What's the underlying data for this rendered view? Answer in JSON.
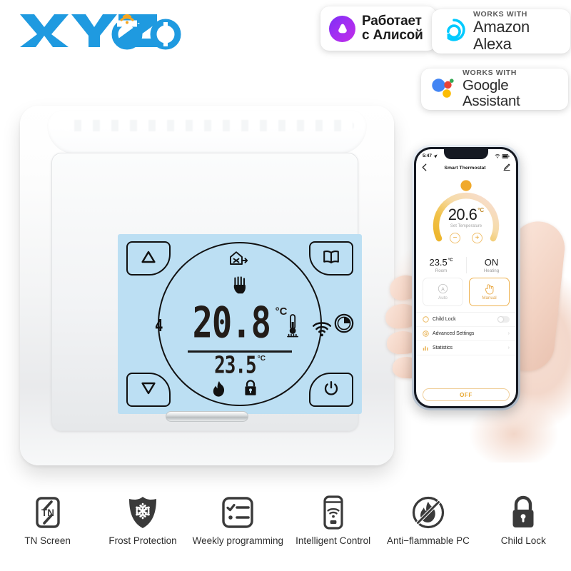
{
  "brand": {
    "logo_text": "XYZOO",
    "logo_color": "#1f9ae0",
    "logo_accent_color": "#f5a623"
  },
  "badges": [
    {
      "id": "alice",
      "icon": "yandex-alice-icon",
      "line1": "Работает",
      "line2": "с Алисой",
      "color": "#9B30E8"
    },
    {
      "id": "alexa",
      "icon": "amazon-alexa-icon",
      "kicker": "WORKS WITH",
      "name": "Amazon Alexa",
      "color": "#00CAFF"
    },
    {
      "id": "google",
      "icon": "google-assistant-icon",
      "kicker": "WORKS WITH",
      "name": "Google Assistant",
      "colors": [
        "#4285F4",
        "#EA4335",
        "#FBBC05",
        "#34A853"
      ]
    }
  ],
  "thermostat": {
    "lcd": {
      "background_color": "#bcdff3",
      "main_temp": "20.8",
      "main_unit": "°C",
      "set_temp": "23.5",
      "set_unit": "°C",
      "day_indicator": "4",
      "icons": {
        "up_key": "up-arrow-icon",
        "book_key": "program-book-icon",
        "down_key": "down-arrow-icon",
        "power_key": "power-icon",
        "frost_house": "frost-protection-house-icon",
        "hand": "manual-hand-icon",
        "thermometer": "floor-sensor-thermometer-icon",
        "wifi": "wifi-icon",
        "clock": "clock-icon",
        "flame": "heating-flame-icon",
        "lock": "child-lock-icon"
      }
    }
  },
  "phone": {
    "status_bar": {
      "time": "5:47",
      "location_icon": "location-arrow-icon",
      "wifi_icon": "wifi-icon",
      "battery_icon": "battery-icon"
    },
    "nav": {
      "back_icon": "back-chevron-icon",
      "title": "Smart Thermostat",
      "edit_icon": "edit-pencil-icon"
    },
    "dial": {
      "set_temperature": "20.6",
      "unit": "°C",
      "caption": "Set Temperature",
      "minus_label": "−",
      "plus_label": "+",
      "arc_color_start": "#f0b323",
      "arc_color_end": "#f7d7d2",
      "knob_color": "#f0a92b"
    },
    "readouts": [
      {
        "value": "23.5",
        "unit": "°C",
        "caption": "Room"
      },
      {
        "value": "ON",
        "unit": "",
        "caption": "Heating"
      }
    ],
    "modes": [
      {
        "label": "Auto",
        "icon": "auto-mode-icon",
        "selected": false
      },
      {
        "label": "Manual",
        "icon": "manual-hand-icon",
        "selected": true
      }
    ],
    "rows": [
      {
        "label": "Child Lock",
        "icon": "child-lock-icon",
        "control": "toggle",
        "value": "off"
      },
      {
        "label": "Advanced Settings",
        "icon": "settings-gear-icon",
        "control": "chevron",
        "value": "›"
      },
      {
        "label": "Statistics",
        "icon": "statistics-bars-icon",
        "control": "chevron",
        "value": "›"
      }
    ],
    "power_button": "OFF",
    "accent_color": "#e7a52c"
  },
  "features": [
    {
      "label": "TN Screen",
      "icon": "tn-screen-icon"
    },
    {
      "label": "Frost Protection",
      "icon": "frost-shield-icon"
    },
    {
      "label": "Weekly programming",
      "icon": "checklist-icon"
    },
    {
      "label": "Intelligent Control",
      "icon": "phone-wifi-icon"
    },
    {
      "label": "Anti−flammable PC",
      "icon": "no-flame-icon"
    },
    {
      "label": "Child Lock",
      "icon": "padlock-icon"
    }
  ]
}
